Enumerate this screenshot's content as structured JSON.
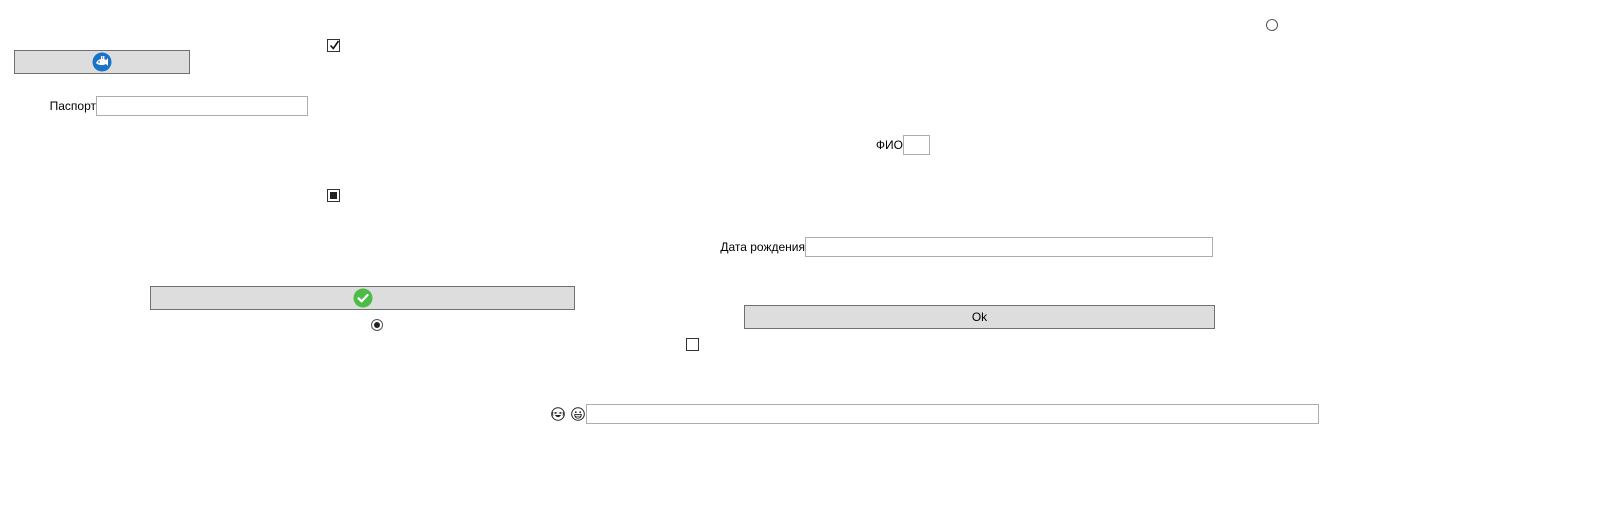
{
  "form": {
    "passport_label": "Паспорт",
    "passport_value": "",
    "fio_label": "ФИО",
    "fio_value": "",
    "birthdate_label": "Дата рождения",
    "birthdate_value": "",
    "ok_button_label": "Ok",
    "emoji_input_value": ""
  },
  "icons": {
    "top_button_icon": "fish-logo-icon",
    "check_button_icon": "green-check-icon",
    "emoji_1": "laughing-face-icon",
    "emoji_2": "grinning-face-icon"
  },
  "controls": {
    "checkbox_top_checked": true,
    "checkbox_middle_state": "indeterminate",
    "checkbox_bottom_checked": false,
    "radio_top_selected": false,
    "radio_bottom_selected": true
  },
  "colors": {
    "button_bg": "#dddddd",
    "button_border": "#707070",
    "input_border": "#abadb3",
    "check_green": "#4cbb47",
    "logo_blue": "#1a73c9"
  }
}
